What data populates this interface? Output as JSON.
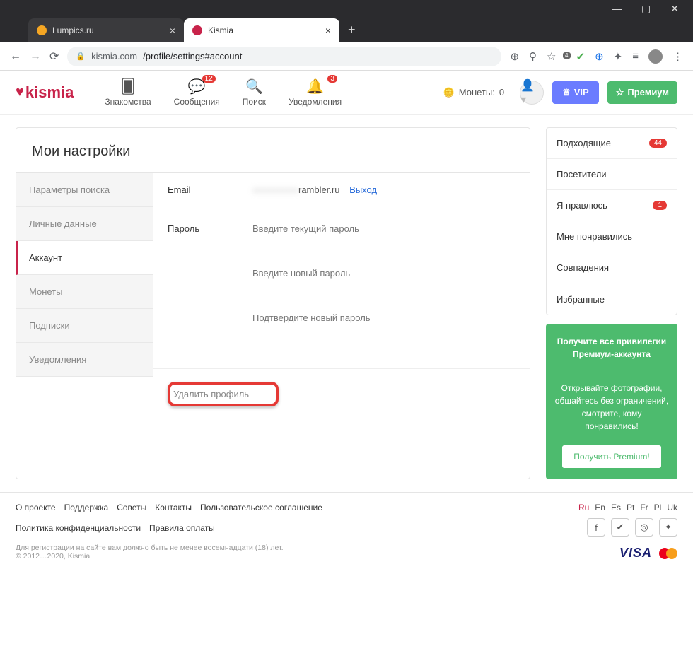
{
  "browser": {
    "tabs": [
      {
        "title": "Lumpics.ru",
        "favicon": "#f5a623"
      },
      {
        "title": "Kismia",
        "favicon": "#c8234a"
      }
    ],
    "url_host": "kismia.com",
    "url_path": "/profile/settings#account",
    "ext_badge": "4"
  },
  "header": {
    "logo": "kismia",
    "nav": [
      {
        "icon": "cards",
        "label": "Знакомства",
        "badge": ""
      },
      {
        "icon": "chat",
        "label": "Сообщения",
        "badge": "12"
      },
      {
        "icon": "search",
        "label": "Поиск",
        "badge": ""
      },
      {
        "icon": "bell",
        "label": "Уведомления",
        "badge": "3"
      }
    ],
    "coins_label": "Монеты:",
    "coins_value": "0",
    "vip": "VIP",
    "premium": "Премиум"
  },
  "settings": {
    "title": "Мои настройки",
    "tabs": [
      "Параметры поиска",
      "Личные данные",
      "Аккаунт",
      "Монеты",
      "Подписки",
      "Уведомления"
    ],
    "active_index": 2,
    "email_label": "Email",
    "email_value": "rambler.ru",
    "logout": "Выход",
    "password_label": "Пароль",
    "pwd_current": "Введите текущий пароль",
    "pwd_new": "Введите новый пароль",
    "pwd_confirm": "Подтвердите новый пароль",
    "delete": "Удалить профиль"
  },
  "sidebar": {
    "items": [
      {
        "label": "Подходящие",
        "badge": "44"
      },
      {
        "label": "Посетители",
        "badge": ""
      },
      {
        "label": "Я нравлюсь",
        "badge": "1"
      },
      {
        "label": "Мне понравились",
        "badge": ""
      },
      {
        "label": "Совпадения",
        "badge": ""
      },
      {
        "label": "Избранные",
        "badge": ""
      }
    ],
    "premium": {
      "line1": "Получите все привилегии Премиум-аккаунта",
      "line2": "Открывайте фотографии, общайтесь без ограничений, смотрите, кому понравились!",
      "button": "Получить Premium!"
    }
  },
  "footer": {
    "links": [
      "О проекте",
      "Поддержка",
      "Советы",
      "Контакты",
      "Пользовательское соглашение",
      "Политика конфиденциальности",
      "Правила оплаты"
    ],
    "langs": [
      "Ru",
      "En",
      "Es",
      "Pt",
      "Fr",
      "Pl",
      "Uk"
    ],
    "active_lang": "Ru",
    "disclaimer": "Для регистрации на сайте вам должно быть не менее восемнадцати (18) лет.",
    "copyright": "© 2012…2020, Kismia",
    "visa": "VISA"
  }
}
